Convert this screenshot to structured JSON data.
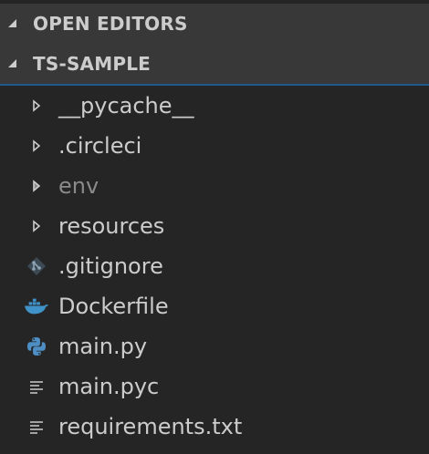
{
  "sections": {
    "open_editors": {
      "label": "OPEN EDITORS",
      "expanded": false
    },
    "project": {
      "label": "TS-SAMPLE",
      "expanded": true
    }
  },
  "tree": [
    {
      "name": "__pycache__",
      "kind": "folder",
      "icon": "chevron-right-icon"
    },
    {
      "name": ".circleci",
      "kind": "folder",
      "icon": "chevron-right-icon"
    },
    {
      "name": "env",
      "kind": "folder",
      "icon": "chevron-right-icon",
      "dimmed": true
    },
    {
      "name": "resources",
      "kind": "folder",
      "icon": "chevron-right-icon"
    },
    {
      "name": ".gitignore",
      "kind": "file",
      "icon": "git-icon"
    },
    {
      "name": "Dockerfile",
      "kind": "file",
      "icon": "docker-icon"
    },
    {
      "name": "main.py",
      "kind": "file",
      "icon": "python-icon"
    },
    {
      "name": "main.pyc",
      "kind": "file",
      "icon": "text-file-icon"
    },
    {
      "name": "requirements.txt",
      "kind": "file",
      "icon": "text-file-icon"
    }
  ],
  "colors": {
    "background": "#252526",
    "header_background": "#383838",
    "focus_border": "#1f5a8c",
    "text": "#cccccc",
    "dim_text": "#8a8a8a",
    "docker": "#3f93c8",
    "python": "#4d8fc4"
  }
}
